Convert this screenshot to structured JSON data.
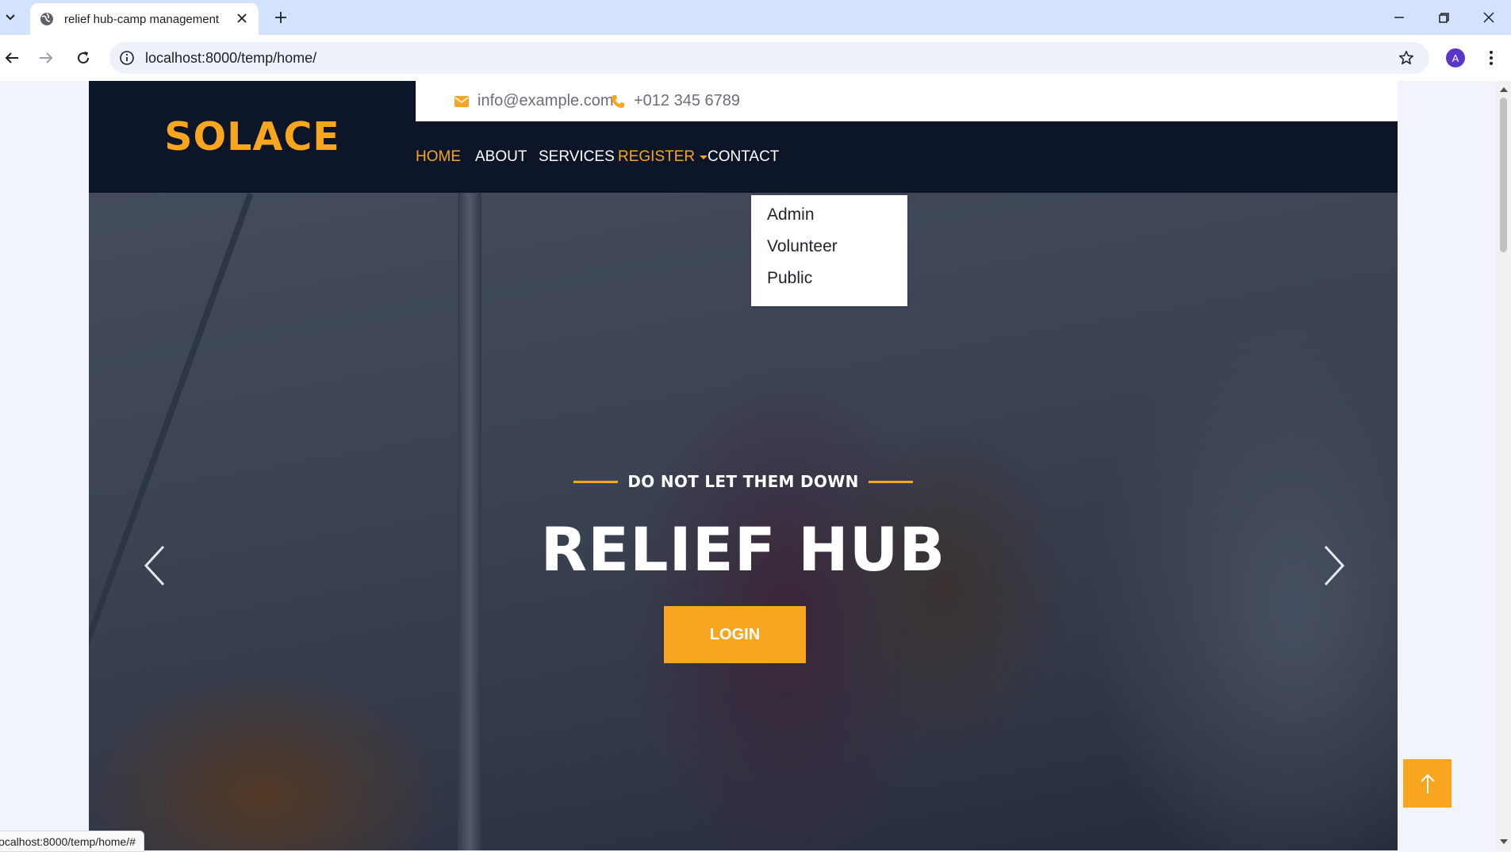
{
  "browser": {
    "tab_title": "relief hub-camp management",
    "url": "localhost:8000/temp/home/",
    "profile_initial": "A",
    "status_url": "localhost:8000/temp/home/#"
  },
  "header": {
    "brand": "SOLACE",
    "email": "info@example.com",
    "phone": "+012 345 6789"
  },
  "nav": {
    "items": [
      {
        "label": "HOME",
        "active": true
      },
      {
        "label": "ABOUT",
        "active": false
      },
      {
        "label": "SERVICES",
        "active": false
      },
      {
        "label": "REGISTER",
        "active": true,
        "dropdown": true
      },
      {
        "label": "CONTACT",
        "active": false
      }
    ],
    "register_menu": [
      "Admin",
      "Volunteer",
      "Public"
    ]
  },
  "hero": {
    "subtitle": "DO NOT LET THEM DOWN",
    "title": "RELIEF HUB",
    "button": "LOGIN"
  },
  "colors": {
    "accent": "#f8a51f",
    "navy": "#0d1628",
    "chrome_tabbar": "#d3e3fd"
  },
  "icons": [
    "tab-list-icon",
    "globe-icon",
    "close-icon",
    "new-tab-icon",
    "minimize-icon",
    "restore-icon",
    "window-close-icon",
    "back-icon",
    "forward-icon",
    "reload-icon",
    "site-info-icon",
    "bookmark-star-icon",
    "menu-kebab-icon",
    "envelope-icon",
    "phone-icon",
    "chevron-left-icon",
    "chevron-right-icon",
    "arrow-up-icon"
  ]
}
